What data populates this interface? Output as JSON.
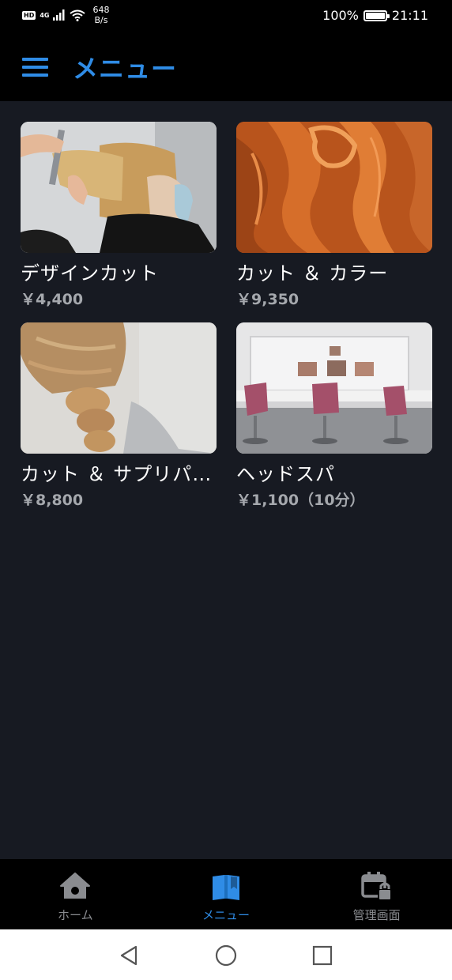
{
  "status_bar": {
    "hd": "HD",
    "network": "4G",
    "speed_value": "648",
    "speed_unit": "B/s",
    "battery": "100%",
    "time": "21:11",
    "battery_level": 1.0
  },
  "header": {
    "title": "メニュー",
    "menu_icon": "hamburger-icon"
  },
  "menu_items": [
    {
      "name": "デザインカット",
      "price": "￥4,400",
      "image": "haircut-photo"
    },
    {
      "name": "カット ＆ カラー",
      "price": "￥9,350",
      "image": "colored-hair-photo"
    },
    {
      "name": "カット ＆ サプリパ…",
      "price": "￥8,800",
      "image": "braided-hair-photo"
    },
    {
      "name": "ヘッドスパ",
      "price": "￥1,100（10分）",
      "image": "salon-interior-photo"
    }
  ],
  "bottom_nav": {
    "items": [
      {
        "label": "ホーム",
        "icon": "home-icon",
        "active": false
      },
      {
        "label": "メニュー",
        "icon": "book-icon",
        "active": true
      },
      {
        "label": "管理画面",
        "icon": "calendar-lock-icon",
        "active": false
      }
    ]
  },
  "colors": {
    "accent": "#2f8ce6",
    "background": "#171a22",
    "bar": "#000000",
    "inactive": "#8a8c90",
    "price": "#a5a8ad"
  }
}
